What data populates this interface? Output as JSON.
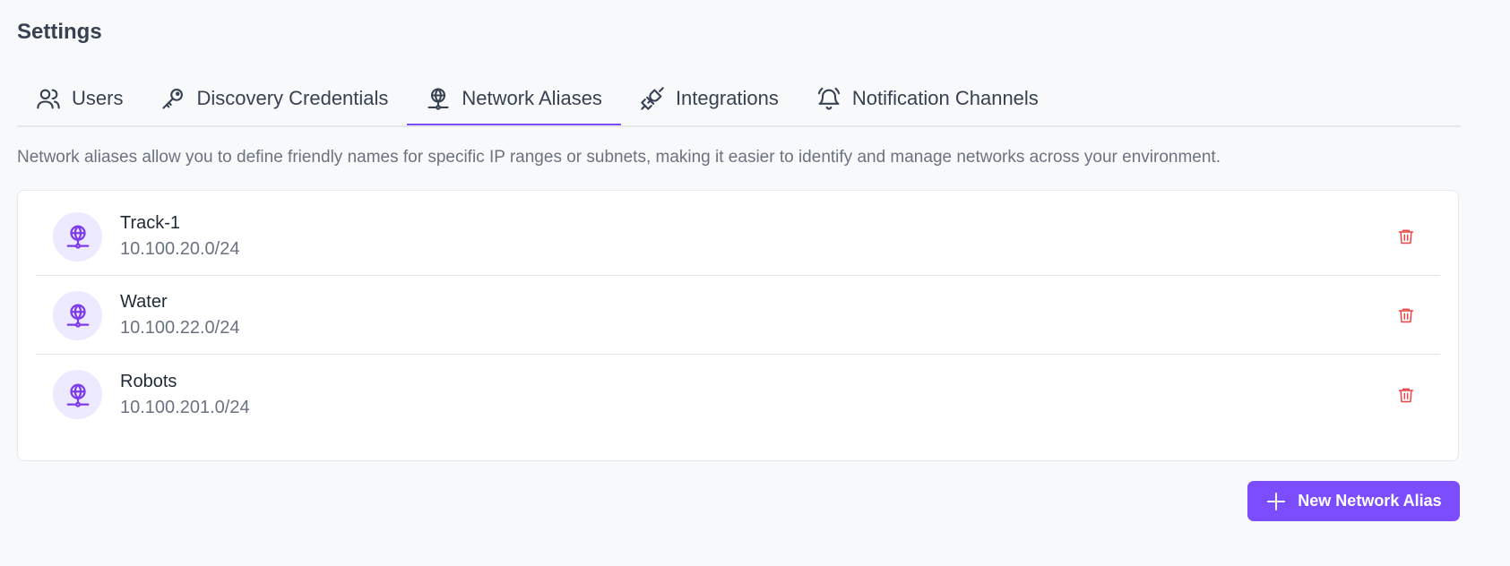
{
  "page": {
    "title": "Settings"
  },
  "tabs": [
    {
      "label": "Users",
      "icon": "users-icon",
      "active": false
    },
    {
      "label": "Discovery Credentials",
      "icon": "key-icon",
      "active": false
    },
    {
      "label": "Network Aliases",
      "icon": "network-globe-icon",
      "active": true
    },
    {
      "label": "Integrations",
      "icon": "plug-icon",
      "active": false
    },
    {
      "label": "Notification Channels",
      "icon": "bell-ring-icon",
      "active": false
    }
  ],
  "description": "Network aliases allow you to define friendly names for specific IP ranges or subnets, making it easier to identify and manage networks across your environment.",
  "aliases": [
    {
      "name": "Track-1",
      "cidr": "10.100.20.0/24"
    },
    {
      "name": "Water",
      "cidr": "10.100.22.0/24"
    },
    {
      "name": "Robots",
      "cidr": "10.100.201.0/24"
    }
  ],
  "actions": {
    "new_label": "New Network Alias"
  },
  "colors": {
    "accent": "#7c4dff",
    "danger": "#ef4444",
    "avatar_bg": "#ede9fe"
  }
}
